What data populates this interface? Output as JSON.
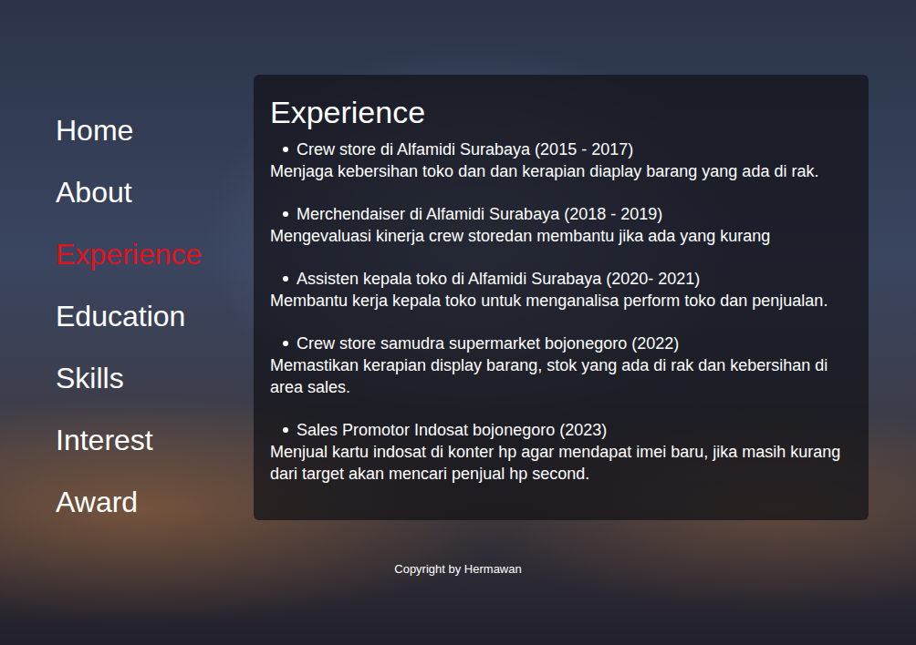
{
  "nav": {
    "items": [
      {
        "label": "Home",
        "selected": false
      },
      {
        "label": "About",
        "selected": false
      },
      {
        "label": "Experience",
        "selected": true
      },
      {
        "label": "Education",
        "selected": false
      },
      {
        "label": "Skills",
        "selected": false
      },
      {
        "label": "Interest",
        "selected": false
      },
      {
        "label": "Award",
        "selected": false
      }
    ]
  },
  "panel": {
    "title": "Experience",
    "items": [
      {
        "role": "Crew store di Alfamidi Surabaya (2015 - 2017)",
        "description": "Menjaga kebersihan toko dan dan kerapian diaplay barang yang ada di rak."
      },
      {
        "role": "Merchendaiser di Alfamidi Surabaya (2018 - 2019)",
        "description": "Mengevaluasi kinerja crew storedan membantu jika ada yang kurang"
      },
      {
        "role": "Assisten kepala toko di Alfamidi Surabaya (2020- 2021)",
        "description": "Membantu kerja kepala toko untuk menganalisa perform toko dan penjualan."
      },
      {
        "role": "Crew store samudra supermarket bojonegoro (2022)",
        "description": "Memastikan kerapian display barang, stok yang ada di rak dan kebersihan di area sales."
      },
      {
        "role": "Sales Promotor Indosat bojonegoro (2023)",
        "description": "Menjual kartu indosat di konter hp agar mendapat imei baru, jika masih kurang dari target akan mencari penjual hp second."
      }
    ]
  },
  "footer": "Copyright by Hermawan"
}
